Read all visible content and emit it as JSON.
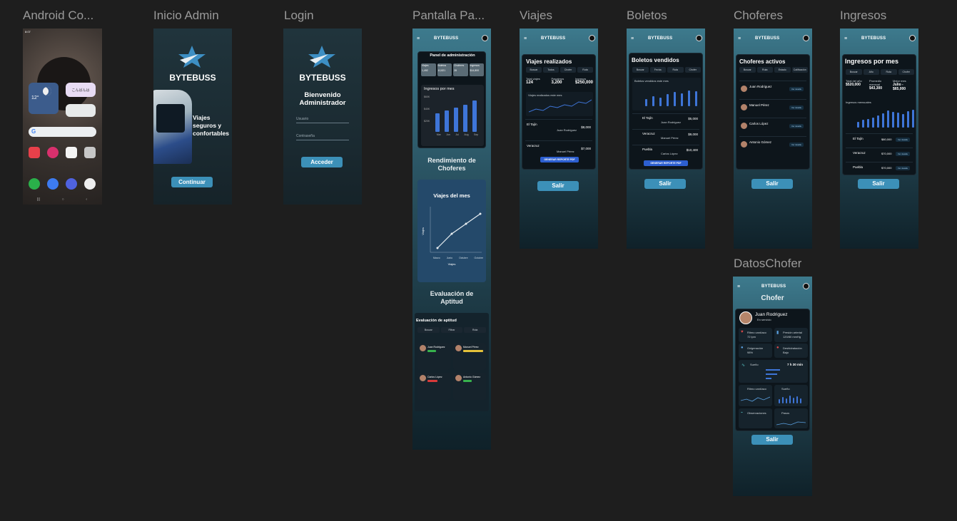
{
  "frames": {
    "android": "Android Co...",
    "inicio": "Inicio Admin",
    "login": "Login",
    "pantalla": "Pantalla Pa...",
    "viajes": "Viajes",
    "boletos": "Boletos",
    "choferes": "Choferes",
    "ingresos": "Ingresos",
    "datos": "DatosChofer"
  },
  "brand": "BYTEBUSS",
  "android": {
    "time": "8:07",
    "weather_temp": "12°",
    "widget_text": "こんばんは",
    "search_logo": "G",
    "apps": [
      "Temu",
      "",
      "Pocket",
      "Google"
    ]
  },
  "inicio": {
    "tagline": "Viajes seguros y confortables",
    "continue_label": "Continuar"
  },
  "login": {
    "welcome": "Bienvenido Administrador",
    "user_label": "Usuario",
    "password_label": "Contraseña",
    "submit_label": "Acceder"
  },
  "pantalla": {
    "panel_title": "Panel de administración",
    "stats": [
      {
        "label": "Viajes",
        "value": "1,492"
      },
      {
        "label": "Boletos",
        "value": "10,821"
      },
      {
        "label": "Choferes",
        "value": "28"
      },
      {
        "label": "Ingresos",
        "value": "$14,800"
      }
    ],
    "chart_title": "Ingresos por mes",
    "ylabels": [
      "$60K",
      "$40K",
      "$20K"
    ],
    "months": [
      "Mar",
      "Jun",
      "Jul",
      "Aug",
      "Sep"
    ],
    "rendimiento": "Rendimiento de Choferes",
    "viajes_mes": "Viajes del mes",
    "line_x": [
      "Marzo",
      "Junio",
      "Octubre",
      "Octubre"
    ],
    "line_xlabel": "Viajes",
    "line_ylabel": "Viajes",
    "evaluacion": "Evaluación de Aptitud",
    "eval_title": "Evaluación de aptitud",
    "eval_chips": [
      "Buscar",
      "Filtrar",
      "Ruta"
    ],
    "drivers": [
      "Juan Rodriguez",
      "Manuel Pérez",
      "Carlos López",
      "Antonio Gómez"
    ]
  },
  "viajes": {
    "title": "Viajes realizados",
    "chips": [
      "Buscar",
      "Todos",
      "Chofer",
      "Ruta"
    ],
    "stats": [
      {
        "label": "Total viajes",
        "value": "124"
      },
      {
        "label": "Pasajeros",
        "value": "3,200"
      },
      {
        "label": "Ingresos",
        "value": "$250,000"
      }
    ],
    "chart_label": "Viajes realizados este mes",
    "rows": [
      {
        "route": "El Tajín",
        "driver": "Juan Rodriguez",
        "amount": "$8,000"
      },
      {
        "route": "Veracruz",
        "driver": "Manuel Pérez",
        "amount": "$7,000"
      }
    ],
    "report": "GENERAR REPORTE PDF",
    "exit": "Salir"
  },
  "boletos": {
    "title": "Boletos vendidos",
    "chips": [
      "Buscar",
      "Fecha",
      "Ruta",
      "Chofer"
    ],
    "chart_label": "Boletos vendidos este mes",
    "rows": [
      {
        "route": "El Tajín",
        "driver": "Juan Rodriguez",
        "amount": "$5,000"
      },
      {
        "route": "Veracruz",
        "driver": "Manuel Pérez",
        "amount": "$9,000"
      },
      {
        "route": "Puebla",
        "driver": "Carlos López",
        "amount": "$10,400"
      }
    ],
    "report": "GENERAR REPORTE PDF",
    "exit": "Salir"
  },
  "choferes": {
    "title": "Choferes activos",
    "chips": [
      "Buscar",
      "Ruta",
      "Estado",
      "Calificación"
    ],
    "drivers": [
      "Juan Rodriguez",
      "Manuel Pérez",
      "Carlos López",
      "Antonio Gómez"
    ],
    "action": "Ver detalle",
    "exit": "Salir"
  },
  "ingresos": {
    "title": "Ingresos por mes",
    "chips": [
      "Buscar",
      "Año",
      "Ruta",
      "Chofer"
    ],
    "stats": [
      {
        "label": "Total del año",
        "value": "$520,000"
      },
      {
        "label": "Promedio mensual",
        "value": "$43,300"
      },
      {
        "label": "Mejor mes",
        "value": "Julio - $65,000"
      }
    ],
    "chart_label": "Ingresos mensuales",
    "rows": [
      {
        "route": "El Tajín",
        "amount": "$80,000"
      },
      {
        "route": "Veracruz",
        "amount": "$70,000"
      },
      {
        "route": "Puebla",
        "amount": "$70,000"
      }
    ],
    "action": "Ver detalle",
    "exit": "Salir"
  },
  "datos": {
    "title": "Chofer",
    "name": "Juan Rodriguez",
    "status": "En servicio",
    "metrics": [
      {
        "label": "Ritmo cardíaco",
        "value": "72 lpm"
      },
      {
        "label": "Presión arterial",
        "value": "120/80 mmHg"
      },
      {
        "label": "Oxigenación",
        "value": "98%"
      },
      {
        "label": "Deshidratación",
        "value": "Bajo"
      }
    ],
    "sleep_label": "Sueño",
    "sleep_value": "7 h 30 min",
    "ritmo": "Ritmo cardíaco",
    "sueno": "Sueño",
    "obs": "Observaciones",
    "pasos": "Pasos",
    "exit": "Salir"
  },
  "colors": {
    "accent": "#3c90b8",
    "bar": "#3e75d8",
    "teal": "#3d7a8d"
  }
}
